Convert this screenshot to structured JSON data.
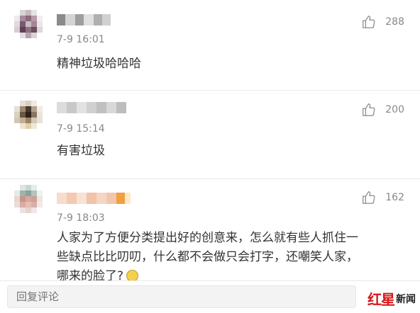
{
  "comments": [
    {
      "time": "7-9 16:01",
      "likes": "288",
      "lines": [
        "精神垃圾哈哈哈"
      ]
    },
    {
      "time": "7-9 15:14",
      "likes": "200",
      "lines": [
        "有害垃圾"
      ]
    },
    {
      "time": "7-9 18:03",
      "likes": "162",
      "lines": [
        "人家为了方便分类提出好的创意来，怎么就有些人抓住一",
        "些缺点比比叨叨，什么都不会做只会打字，还嘲笑人家，",
        "哪来的脸了?"
      ]
    }
  ],
  "reply": {
    "placeholder": "回复评论"
  },
  "watermark": {
    "red": "红星",
    "black": "新闻"
  },
  "icons": {
    "like": "thumbs-up-icon",
    "emoji": "emoji-icon"
  },
  "colors": {
    "text": "#333333",
    "meta": "#888888",
    "brand_red": "#d6161a"
  }
}
